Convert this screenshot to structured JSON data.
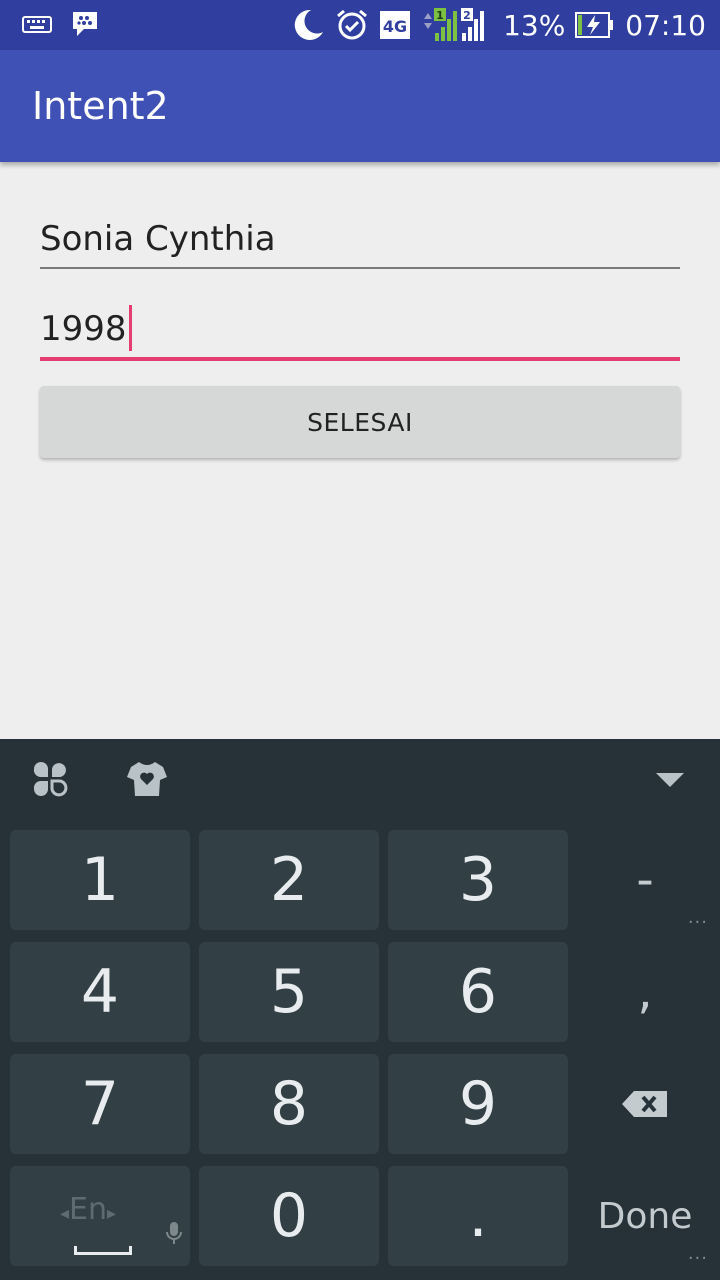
{
  "status_bar": {
    "battery": "13%",
    "time": "07:10",
    "network": "4G",
    "sim1": "1",
    "sim2": "2",
    "icons": [
      "keyboard-icon",
      "bbm-icon",
      "moon-icon",
      "alarm-icon",
      "network-4g-icon",
      "signal-icon",
      "battery-charging-icon"
    ]
  },
  "app_bar": {
    "title": "Intent2"
  },
  "form": {
    "name_value": "Sonia Cynthia",
    "year_value": "1998",
    "submit_label": "SELESAI"
  },
  "keyboard": {
    "keys": [
      "1",
      "2",
      "3",
      "4",
      "5",
      "6",
      "7",
      "8",
      "9",
      "0",
      "."
    ],
    "side_keys": {
      "dash": "-",
      "comma": ",",
      "done": "Done"
    },
    "language": "En",
    "toolbar_icons": [
      "apps-icon",
      "theme-shirt-icon",
      "collapse-keyboard-icon"
    ]
  },
  "colors": {
    "status_bar": "#303f9f",
    "app_bar": "#3f51b5",
    "accent": "#e53d72",
    "keyboard_bg": "#263238",
    "key_bg": "#323f45"
  }
}
